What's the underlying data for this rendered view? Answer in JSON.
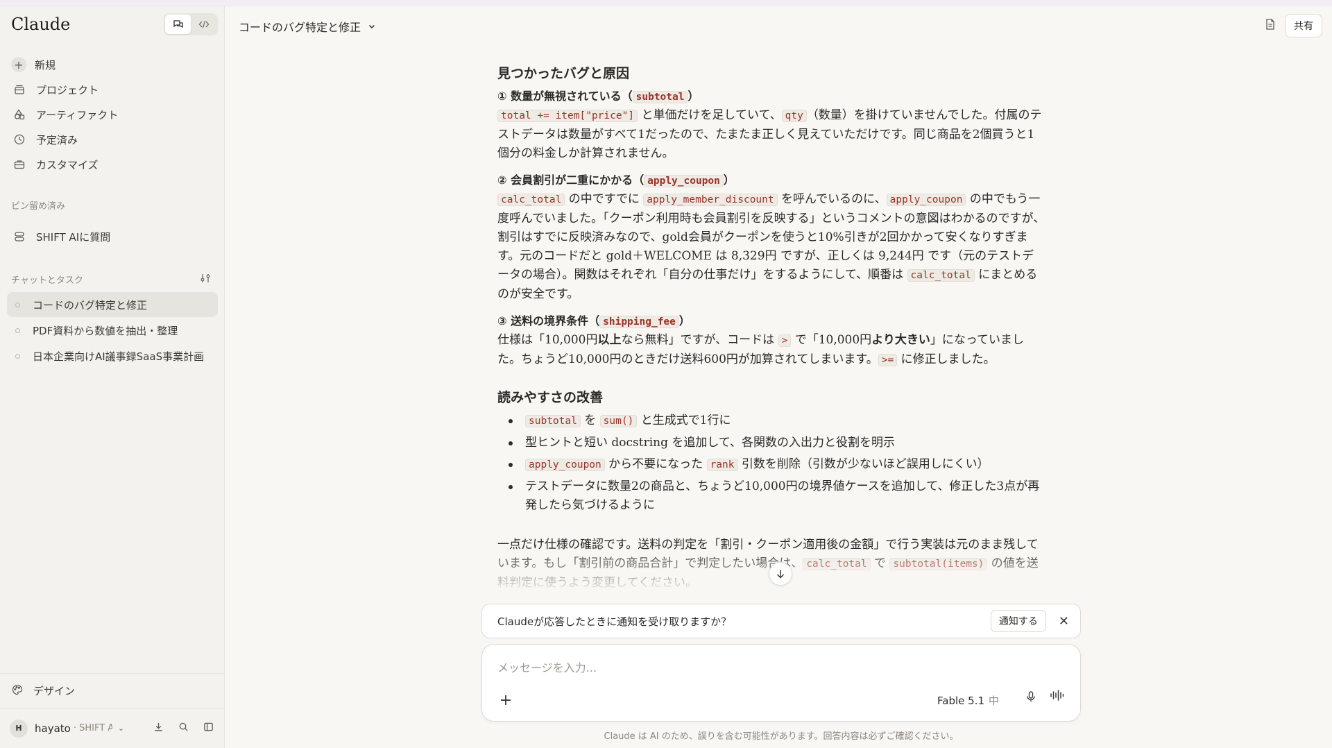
{
  "sidebar": {
    "brand": "Claude",
    "nav": [
      {
        "label": "新規",
        "icon": "plus-icon"
      },
      {
        "label": "プロジェクト",
        "icon": "projects-icon"
      },
      {
        "label": "アーティファクト",
        "icon": "artifacts-icon"
      },
      {
        "label": "予定済み",
        "icon": "clock-icon"
      },
      {
        "label": "カスタマイズ",
        "icon": "briefcase-icon"
      }
    ],
    "pinned_title": "ピン留め済み",
    "pinned": [
      {
        "label": "SHIFT AIに質問",
        "icon": "pin-project-icon"
      }
    ],
    "chats_title": "チャットとタスク",
    "chats": [
      {
        "label": "コードのバグ特定と修正",
        "active": true
      },
      {
        "label": "PDF資料から数値を抽出・整理",
        "active": false
      },
      {
        "label": "日本企業向けAI議事録SaaS事業計画",
        "active": false
      }
    ],
    "design_label": "デザイン",
    "user": {
      "initial": "H",
      "name": "hayato",
      "org": "· SHIFT AI"
    }
  },
  "header": {
    "title": "コードのバグ特定と修正",
    "share_label": "共有"
  },
  "content": {
    "h_bugs": "見つかったバグと原因",
    "b1_title_pre": "① 数量が無視されている（",
    "b1_title_code": "subtotal",
    "b1_title_post": "）",
    "b1_code1": "total += item[\"price\"]",
    "b1_t1": " と単価だけを足していて、",
    "b1_code2": "qty",
    "b1_t2": "（数量）を掛けていませんでした。付属のテストデータは数量がすべて1だったので、たまたま正しく見えていただけです。同じ商品を2個買うと1個分の料金しか計算されません。",
    "b2_title_pre": "② 会員割引が二重にかかる（",
    "b2_title_code": "apply_coupon",
    "b2_title_post": "）",
    "b2_code1": "calc_total",
    "b2_t1": " の中ですでに ",
    "b2_code2": "apply_member_discount",
    "b2_t2": " を呼んでいるのに、",
    "b2_code3": "apply_coupon",
    "b2_t3": " の中でもう一度呼んでいました。「クーポン利用時も会員割引を反映する」というコメントの意図はわかるのですが、割引はすでに反映済みなので、gold会員がクーポンを使うと10%引きが2回かかって安くなりすぎます。元のコードだと gold＋WELCOME は 8,329円 ですが、正しくは 9,244円 です（元のテストデータの場合）。関数はそれぞれ「自分の仕事だけ」をするようにして、順番は ",
    "b2_code4": "calc_total",
    "b2_t4": " にまとめるのが安全です。",
    "b3_title_pre": "③ 送料の境界条件（",
    "b3_title_code": "shipping_fee",
    "b3_title_post": "）",
    "b3_t1": "仕様は「10,000円",
    "b3_b1": "以上",
    "b3_t2": "なら無料」ですが、コードは ",
    "b3_code1": ">",
    "b3_t3": " で「10,000円",
    "b3_b2": "より大きい",
    "b3_t4": "」になっていました。ちょうど10,000円のときだけ送料600円が加算されてしまいます。",
    "b3_code2": ">=",
    "b3_t5": " に修正しました。",
    "h_read": "読みやすさの改善",
    "li1_code1": "subtotal",
    "li1_t1": " を ",
    "li1_code2": "sum()",
    "li1_t2": " と生成式で1行に",
    "li2": "型ヒントと短い docstring を追加して、各関数の入出力と役割を明示",
    "li3_code1": "apply_coupon",
    "li3_t1": " から不要になった ",
    "li3_code2": "rank",
    "li3_t2": " 引数を削除（引数が少ないほど誤用しにくい）",
    "li4": "テストデータに数量2の商品と、ちょうど10,000円の境界値ケースを追加して、修正した3点が再発したら気づけるように",
    "last_t1": "一点だけ仕様の確認です。送料の判定を「割引・クーポン適用後の金額」で行う実装は元のまま残しています。もし「割引前の商品合計」で判定したい場合は、",
    "last_code1": "calc_total",
    "last_t2": " で ",
    "last_code2": "subtotal(items)",
    "last_t3": " の値を送料判定に使うよう変更してください。"
  },
  "notify": {
    "text": "Claudeが応答したときに通知を受け取りますか？",
    "button": "通知する"
  },
  "composer": {
    "placeholder": "メッセージを入力...",
    "model": "Fable 5.1",
    "effort": "中"
  },
  "disclaimer": "Claude は AI のため、誤りを含む可能性があります。回答内容は必ずご確認ください。"
}
